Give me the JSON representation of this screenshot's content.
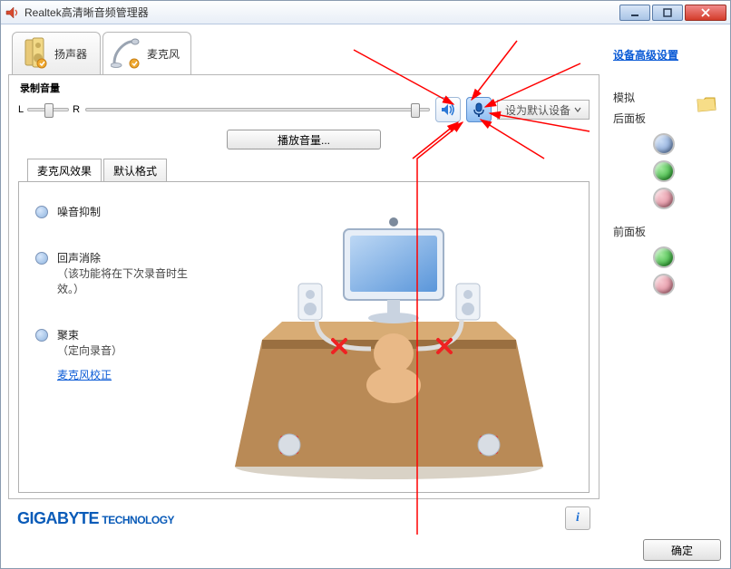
{
  "window": {
    "title": "Realtek高清晰音频管理器"
  },
  "device_tabs": {
    "speaker": "扬声器",
    "mic": "麦克风"
  },
  "recording": {
    "label": "录制音量",
    "L": "L",
    "R": "R"
  },
  "buttons": {
    "play_volume": "播放音量...",
    "set_default": "设为默认设备",
    "ok": "确定"
  },
  "sub_tabs": {
    "effects": "麦克风效果",
    "default_fmt": "默认格式"
  },
  "options": {
    "noise": "噪音抑制",
    "echo_title": "回声消除",
    "echo_sub": "（该功能将在下次录音时生效。）",
    "beam_title": "聚束",
    "beam_sub": "（定向录音）",
    "calibrate": "麦克风校正"
  },
  "right": {
    "advanced": "设备高级设置",
    "analog": "模拟",
    "rear": "后面板",
    "front": "前面板"
  },
  "brand": {
    "name": "GIGABYTE",
    "sub": "TECHNOLOGY"
  },
  "icons": {
    "speaker_tab": "speaker-icon",
    "mic_titlebar": "speaker-red-icon",
    "info": "i"
  }
}
